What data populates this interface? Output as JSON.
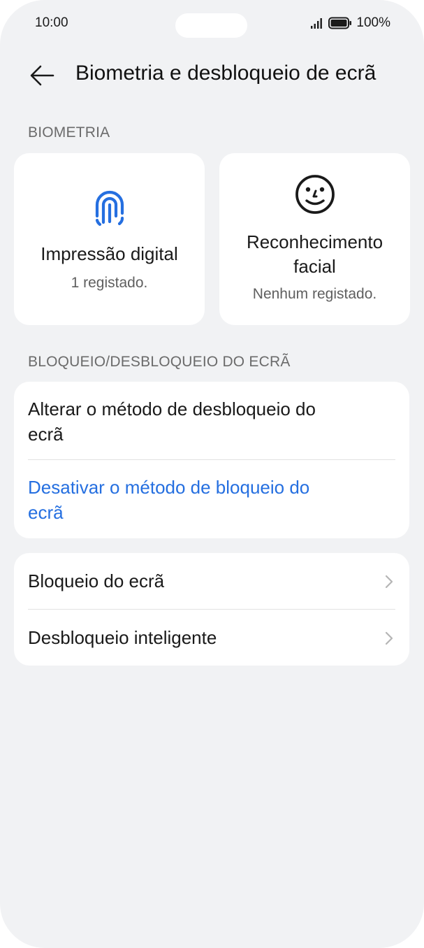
{
  "status_bar": {
    "time": "10:00",
    "battery_text": "100%"
  },
  "header": {
    "title": "Biometria e desbloqueio de ecrã",
    "back_icon": "arrow-left-icon"
  },
  "biometrics": {
    "section_label": "BIOMETRIA",
    "fingerprint": {
      "title": "Impressão digital",
      "subtitle": "1 registado.",
      "icon": "fingerprint-icon"
    },
    "face": {
      "title_line1": "Reconhecimento",
      "title_line2": "facial",
      "subtitle": "Nenhum registado.",
      "icon": "smiley-face-icon"
    }
  },
  "lock_section": {
    "section_label": "BLOQUEIO/DESBLOQUEIO DO ECRÃ",
    "change_method_line1": "Alterar o método de desbloqueio do",
    "change_method_line2": "ecrã",
    "disable_method_line1": "Desativar o método de bloqueio do",
    "disable_method_line2": "ecrã"
  },
  "more_settings": {
    "screen_lock": "Bloqueio do ecrã",
    "smart_unlock": "Desbloqueio inteligente"
  },
  "colors": {
    "accent": "#256fe0",
    "background": "#f1f2f4",
    "card": "#ffffff"
  }
}
